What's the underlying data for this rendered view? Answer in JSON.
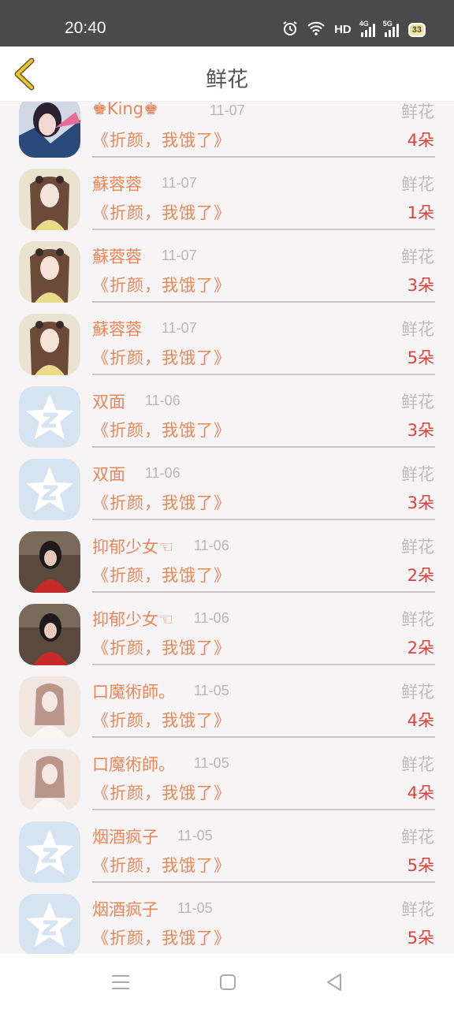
{
  "status": {
    "time": "20:40",
    "hd": "HD",
    "net1": "4G",
    "net2": "5G",
    "battery": "33"
  },
  "header": {
    "title": "鲜花",
    "back_icon": "chevron-left-icon"
  },
  "colors": {
    "accent": "#f0c419",
    "name": "#e8875a",
    "count": "#d9433f",
    "muted": "#bdbdbd"
  },
  "rows": [
    {
      "name": "♚King♚",
      "date": "11-07",
      "gift": "鲜花",
      "book": "《折颜，我饿了》",
      "count": "4朵",
      "avatar": "anime-girl-dark"
    },
    {
      "name": "蘇蓉蓉",
      "date": "11-07",
      "gift": "鲜花",
      "book": "《折颜，我饿了》",
      "count": "1朵",
      "avatar": "anime-girl-light"
    },
    {
      "name": "蘇蓉蓉",
      "date": "11-07",
      "gift": "鲜花",
      "book": "《折颜，我饿了》",
      "count": "3朵",
      "avatar": "anime-girl-light"
    },
    {
      "name": "蘇蓉蓉",
      "date": "11-07",
      "gift": "鲜花",
      "book": "《折颜，我饿了》",
      "count": "5朵",
      "avatar": "anime-girl-light"
    },
    {
      "name": "双面",
      "date": "11-06",
      "gift": "鲜花",
      "book": "《折颜，我饿了》",
      "count": "3朵",
      "avatar": "default-star"
    },
    {
      "name": "双面",
      "date": "11-06",
      "gift": "鲜花",
      "book": "《折颜，我饿了》",
      "count": "3朵",
      "avatar": "default-star"
    },
    {
      "name": "抑郁少女☜",
      "date": "11-06",
      "gift": "鲜花",
      "book": "《折颜，我饿了》",
      "count": "2朵",
      "avatar": "photo-girl-red"
    },
    {
      "name": "抑郁少女☜",
      "date": "11-06",
      "gift": "鲜花",
      "book": "《折颜，我饿了》",
      "count": "2朵",
      "avatar": "photo-girl-red"
    },
    {
      "name": "口魔術師。",
      "date": "11-05",
      "gift": "鲜花",
      "book": "《折颜，我饿了》",
      "count": "4朵",
      "avatar": "photo-girl-pale"
    },
    {
      "name": "口魔術師。",
      "date": "11-05",
      "gift": "鲜花",
      "book": "《折颜，我饿了》",
      "count": "4朵",
      "avatar": "photo-girl-pale"
    },
    {
      "name": "烟酒疯子",
      "date": "11-05",
      "gift": "鲜花",
      "book": "《折颜，我饿了》",
      "count": "5朵",
      "avatar": "default-star"
    },
    {
      "name": "烟酒疯子",
      "date": "11-05",
      "gift": "鲜花",
      "book": "《折颜，我饿了》",
      "count": "5朵",
      "avatar": "default-star"
    }
  ],
  "navbar": {
    "menu_icon": "menu-icon",
    "home_icon": "home-square-icon",
    "back_icon": "back-triangle-icon"
  }
}
